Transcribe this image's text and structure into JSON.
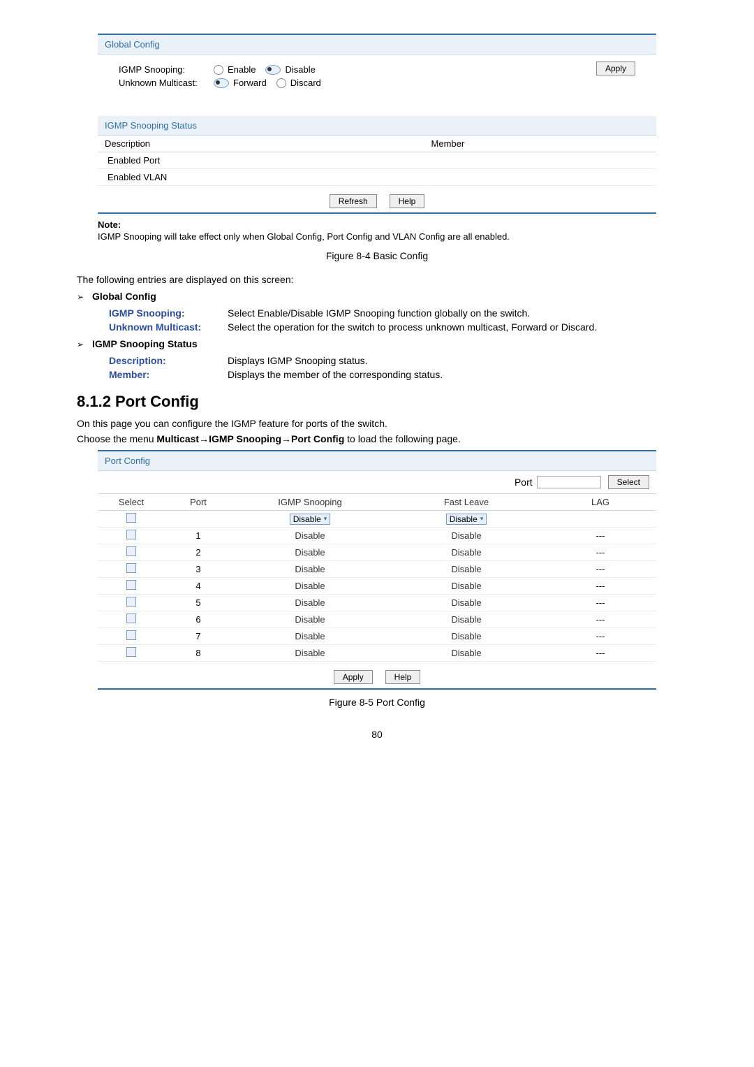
{
  "fig1": {
    "panel1_title": "Global Config",
    "r1_label": "IGMP Snooping:",
    "r1_opt1": "Enable",
    "r1_opt2": "Disable",
    "r2_label": "Unknown Multicast:",
    "r2_opt1": "Forward",
    "r2_opt2": "Discard",
    "apply": "Apply",
    "panel2_title": "IGMP Snooping Status",
    "hdr_desc": "Description",
    "hdr_member": "Member",
    "row1": "Enabled Port",
    "row2": "Enabled VLAN",
    "refresh": "Refresh",
    "help": "Help",
    "note_title": "Note:",
    "note_text": "IGMP Snooping will take effect only when Global Config, Port Config and VLAN Config are all enabled.",
    "caption": "Figure 8-4 Basic Config"
  },
  "body": {
    "p1": "The following entries are displayed on this screen:",
    "b1": "Global Config",
    "d1_term": "IGMP Snooping:",
    "d1_desc": "Select Enable/Disable IGMP Snooping function globally on the switch.",
    "d2_term": "Unknown Multicast:",
    "d2_desc": "Select the operation for the switch to process unknown multicast, Forward or Discard.",
    "b2": "IGMP Snooping Status",
    "d3_term": "Description:",
    "d3_desc": "Displays IGMP Snooping status.",
    "d4_term": "Member:",
    "d4_desc": "Displays the member of the corresponding status.",
    "h2": "8.1.2 Port Config",
    "p2": "On this page you can configure the IGMP feature for ports of the switch.",
    "p3a": "Choose the menu ",
    "p3b": "Multicast→IGMP Snooping→Port Config",
    "p3c": " to load the following page."
  },
  "fig2": {
    "panel_title": "Port Config",
    "port_label": "Port",
    "select_btn": "Select",
    "th_select": "Select",
    "th_port": "Port",
    "th_igmp": "IGMP Snooping",
    "th_fast": "Fast Leave",
    "th_lag": "LAG",
    "disable_sel": "Disable",
    "rows": [
      {
        "port": "1",
        "igmp": "Disable",
        "fast": "Disable",
        "lag": "---"
      },
      {
        "port": "2",
        "igmp": "Disable",
        "fast": "Disable",
        "lag": "---"
      },
      {
        "port": "3",
        "igmp": "Disable",
        "fast": "Disable",
        "lag": "---"
      },
      {
        "port": "4",
        "igmp": "Disable",
        "fast": "Disable",
        "lag": "---"
      },
      {
        "port": "5",
        "igmp": "Disable",
        "fast": "Disable",
        "lag": "---"
      },
      {
        "port": "6",
        "igmp": "Disable",
        "fast": "Disable",
        "lag": "---"
      },
      {
        "port": "7",
        "igmp": "Disable",
        "fast": "Disable",
        "lag": "---"
      },
      {
        "port": "8",
        "igmp": "Disable",
        "fast": "Disable",
        "lag": "---"
      }
    ],
    "apply": "Apply",
    "help": "Help",
    "caption": "Figure 8-5 Port Config"
  },
  "pagenum": "80"
}
